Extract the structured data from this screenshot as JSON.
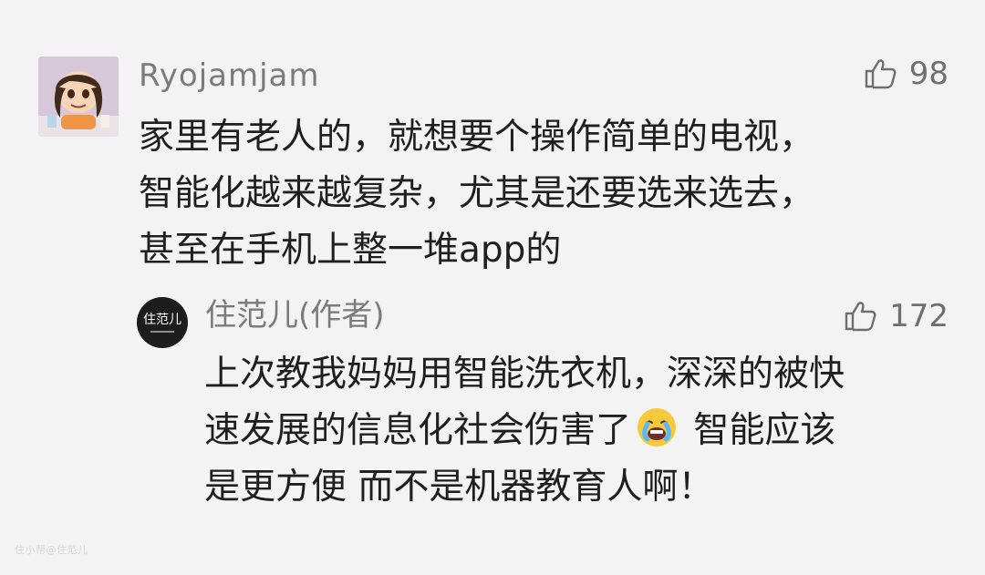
{
  "comment": {
    "username": "Ryojamjam",
    "likes": "98",
    "lines": [
      "家里有老人的，就想要个操作简单的电视，",
      "智能化越来越复杂，尤其是还要选来选去，",
      "甚至在手机上整一堆app的"
    ]
  },
  "reply": {
    "avatar_text": "住范儿",
    "username": "住范儿(作者)",
    "likes": "172",
    "line1": "上次教我妈妈用智能洗衣机，深深的被快",
    "line2_before": "速发展的信息化社会伤害了",
    "line2_after": " 智能应该",
    "line3": "是更方便 而不是机器教育人啊！"
  },
  "watermark": "住小帮@住范儿",
  "icons": {
    "thumb": "thumbs-up-icon",
    "emoji": "crying-face-icon"
  },
  "colors": {
    "background": "#f3f3f3",
    "username": "#7b7b7b",
    "text": "#1f1f1f"
  }
}
